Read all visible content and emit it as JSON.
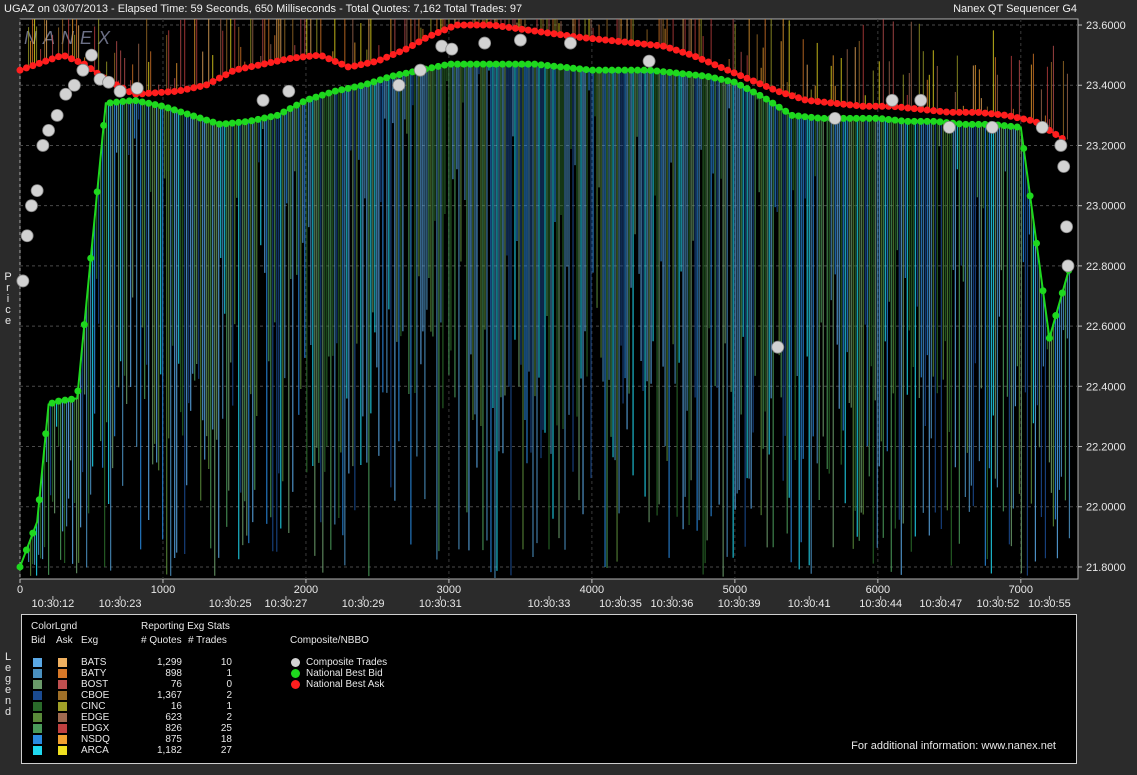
{
  "header": {
    "left": "UGAZ on 03/07/2013  -  Elapsed Time: 59 Seconds, 650 Milliseconds  -  Total Quotes: 7,162  Total Trades: 97",
    "right": "Nanex QT Sequencer G4"
  },
  "watermark": "NANEX",
  "side_labels": {
    "price": "Price",
    "legend": "Legend"
  },
  "chart_data": {
    "type": "line",
    "ylabel": "Price",
    "ylim": [
      21.76,
      23.62
    ],
    "xlim": [
      0,
      7400
    ],
    "y_ticks": [
      "23.6000",
      "23.4000",
      "23.2000",
      "23.0000",
      "22.8000",
      "22.6000",
      "22.4000",
      "22.2000",
      "22.0000",
      "21.8000"
    ],
    "y_tick_values": [
      23.6,
      23.4,
      23.2,
      23.0,
      22.8,
      22.6,
      22.4,
      22.2,
      22.0,
      21.8
    ],
    "x_ticks": [
      "0",
      "1000",
      "2000",
      "3000",
      "4000",
      "5000",
      "6000",
      "7000"
    ],
    "x_tick_values": [
      0,
      1000,
      2000,
      3000,
      4000,
      5000,
      6000,
      7000
    ],
    "time_labels": [
      {
        "x": 230,
        "label": "10:30:12"
      },
      {
        "x": 700,
        "label": "10:30:23"
      },
      {
        "x": 1470,
        "label": "10:30:25"
      },
      {
        "x": 1860,
        "label": "10:30:27"
      },
      {
        "x": 2400,
        "label": "10:30:29"
      },
      {
        "x": 2940,
        "label": "10:30:31"
      },
      {
        "x": 3700,
        "label": "10:30:33"
      },
      {
        "x": 4200,
        "label": "10:30:35"
      },
      {
        "x": 4560,
        "label": "10:30:36"
      },
      {
        "x": 5030,
        "label": "10:30:39"
      },
      {
        "x": 5520,
        "label": "10:30:41"
      },
      {
        "x": 6020,
        "label": "10:30:44"
      },
      {
        "x": 6440,
        "label": "10:30:47"
      },
      {
        "x": 6840,
        "label": "10:30:52"
      },
      {
        "x": 7200,
        "label": "10:30:55"
      }
    ],
    "series": [
      {
        "name": "National Best Ask",
        "color": "#ff1e1e",
        "x": [
          0,
          300,
          450,
          600,
          800,
          1100,
          1300,
          1500,
          1700,
          1900,
          2100,
          2300,
          2500,
          2700,
          2850,
          2950,
          3050,
          3300,
          3600,
          3900,
          4100,
          4300,
          4500,
          4700,
          4900,
          5100,
          5300,
          5500,
          5700,
          5900,
          6100,
          6300,
          6500,
          6700,
          6900,
          7100,
          7300
        ],
        "values": [
          23.45,
          23.5,
          23.47,
          23.42,
          23.37,
          23.38,
          23.4,
          23.45,
          23.47,
          23.49,
          23.5,
          23.46,
          23.48,
          23.52,
          23.56,
          23.58,
          23.6,
          23.6,
          23.58,
          23.56,
          23.55,
          23.54,
          23.53,
          23.5,
          23.46,
          23.42,
          23.38,
          23.35,
          23.34,
          23.33,
          23.33,
          23.32,
          23.31,
          23.31,
          23.3,
          23.28,
          23.22
        ]
      },
      {
        "name": "National Best Bid",
        "color": "#1ed81e",
        "x": [
          0,
          120,
          200,
          260,
          400,
          600,
          800,
          1000,
          1200,
          1400,
          1600,
          1800,
          2000,
          2200,
          2400,
          2600,
          2800,
          3000,
          3200,
          3400,
          3600,
          3800,
          4000,
          4200,
          4400,
          4600,
          4800,
          5000,
          5200,
          5400,
          5600,
          5800,
          6000,
          6200,
          6400,
          6600,
          6800,
          7000,
          7200,
          7350
        ],
        "values": [
          21.8,
          21.95,
          22.34,
          22.35,
          22.36,
          23.34,
          23.35,
          23.33,
          23.3,
          23.27,
          23.28,
          23.3,
          23.35,
          23.38,
          23.4,
          23.43,
          23.45,
          23.47,
          23.47,
          23.47,
          23.47,
          23.46,
          23.45,
          23.45,
          23.45,
          23.44,
          23.43,
          23.41,
          23.36,
          23.3,
          23.29,
          23.29,
          23.29,
          23.28,
          23.28,
          23.27,
          23.27,
          23.26,
          22.56,
          22.81
        ]
      }
    ],
    "trades": {
      "name": "Composite Trades",
      "color": "#d2d2d2",
      "x": [
        20,
        50,
        80,
        120,
        160,
        200,
        260,
        320,
        380,
        440,
        500,
        560,
        620,
        700,
        820,
        1700,
        1880,
        2650,
        2800,
        2950,
        3020,
        3250,
        3500,
        3850,
        4400,
        5300,
        5700,
        6100,
        6300,
        6500,
        6800,
        7150,
        7280,
        7300,
        7320,
        7330
      ],
      "values": [
        22.75,
        22.9,
        23.0,
        23.05,
        23.2,
        23.25,
        23.3,
        23.37,
        23.4,
        23.45,
        23.5,
        23.42,
        23.41,
        23.38,
        23.39,
        23.35,
        23.38,
        23.4,
        23.45,
        23.53,
        23.52,
        23.54,
        23.55,
        23.54,
        23.48,
        22.53,
        23.29,
        23.35,
        23.35,
        23.26,
        23.26,
        23.26,
        23.2,
        23.13,
        22.93,
        22.8
      ]
    }
  },
  "legend": {
    "color_header": "ColorLgnd",
    "bid_header": "Bid",
    "ask_header": "Ask",
    "exg_header": "Exg",
    "stats_header": "Reporting Exg Stats",
    "quotes_header": "# Quotes",
    "trades_header": "# Trades",
    "composite_header": "Composite/NBBO",
    "exchanges": [
      {
        "exg": "BATS",
        "bid_color": "#5aa8e6",
        "ask_color": "#f0b060",
        "quotes": "1,299",
        "trades": "10"
      },
      {
        "exg": "BATY",
        "bid_color": "#4a90c0",
        "ask_color": "#d87828",
        "quotes": "898",
        "trades": "1"
      },
      {
        "exg": "BOST",
        "bid_color": "#6a9a6a",
        "ask_color": "#c05050",
        "quotes": "76",
        "trades": "0"
      },
      {
        "exg": "CBOE",
        "bid_color": "#1a4a90",
        "ask_color": "#a07028",
        "quotes": "1,367",
        "trades": "2"
      },
      {
        "exg": "CINC",
        "bid_color": "#2a6a2a",
        "ask_color": "#a0a028",
        "quotes": "16",
        "trades": "1"
      },
      {
        "exg": "EDGE",
        "bid_color": "#5a8a3a",
        "ask_color": "#a06a50",
        "quotes": "623",
        "trades": "2"
      },
      {
        "exg": "EDGX",
        "bid_color": "#4a9a5a",
        "ask_color": "#c04040",
        "quotes": "826",
        "trades": "25"
      },
      {
        "exg": "NSDQ",
        "bid_color": "#2a8ae0",
        "ask_color": "#f0a030",
        "quotes": "875",
        "trades": "18"
      },
      {
        "exg": "ARCA",
        "bid_color": "#20d8f0",
        "ask_color": "#f0e020",
        "quotes": "1,182",
        "trades": "27"
      }
    ],
    "composite": [
      {
        "label": "Composite Trades",
        "color": "#d2d2d2"
      },
      {
        "label": "National Best Bid",
        "color": "#1ed81e"
      },
      {
        "label": "National Best Ask",
        "color": "#ff1e1e"
      }
    ],
    "footer": "For additional information: www.nanex.net"
  }
}
